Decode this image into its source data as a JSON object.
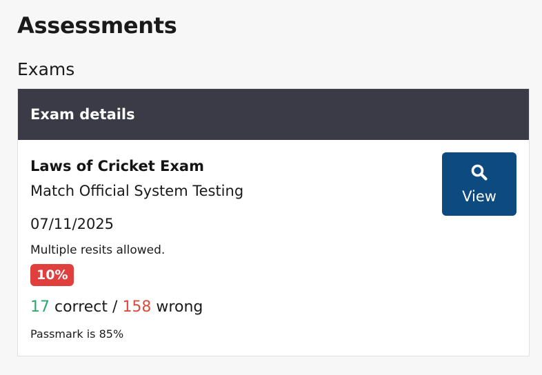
{
  "page": {
    "title": "Assessments",
    "section_title": "Exams"
  },
  "card": {
    "header_title": "Exam details",
    "exam_name": "Laws of Cricket Exam",
    "exam_subtitle": "Match Official System Testing",
    "date": "07/11/2025",
    "resits_note": "Multiple resits allowed.",
    "score_badge": "10%",
    "score_badge_color": "#e0403d",
    "results": {
      "correct_count": "17",
      "correct_label": " correct / ",
      "wrong_count": "158",
      "wrong_label": " wrong",
      "correct_color": "#2aa86a",
      "wrong_color": "#dc4a3b"
    },
    "passmark": "Passmark is 85%",
    "view_button": {
      "label": "View",
      "icon": "search-icon",
      "color": "#0c4a80"
    }
  },
  "colors": {
    "header_bg": "#3a3b46",
    "page_bg": "#f7f7f7"
  }
}
